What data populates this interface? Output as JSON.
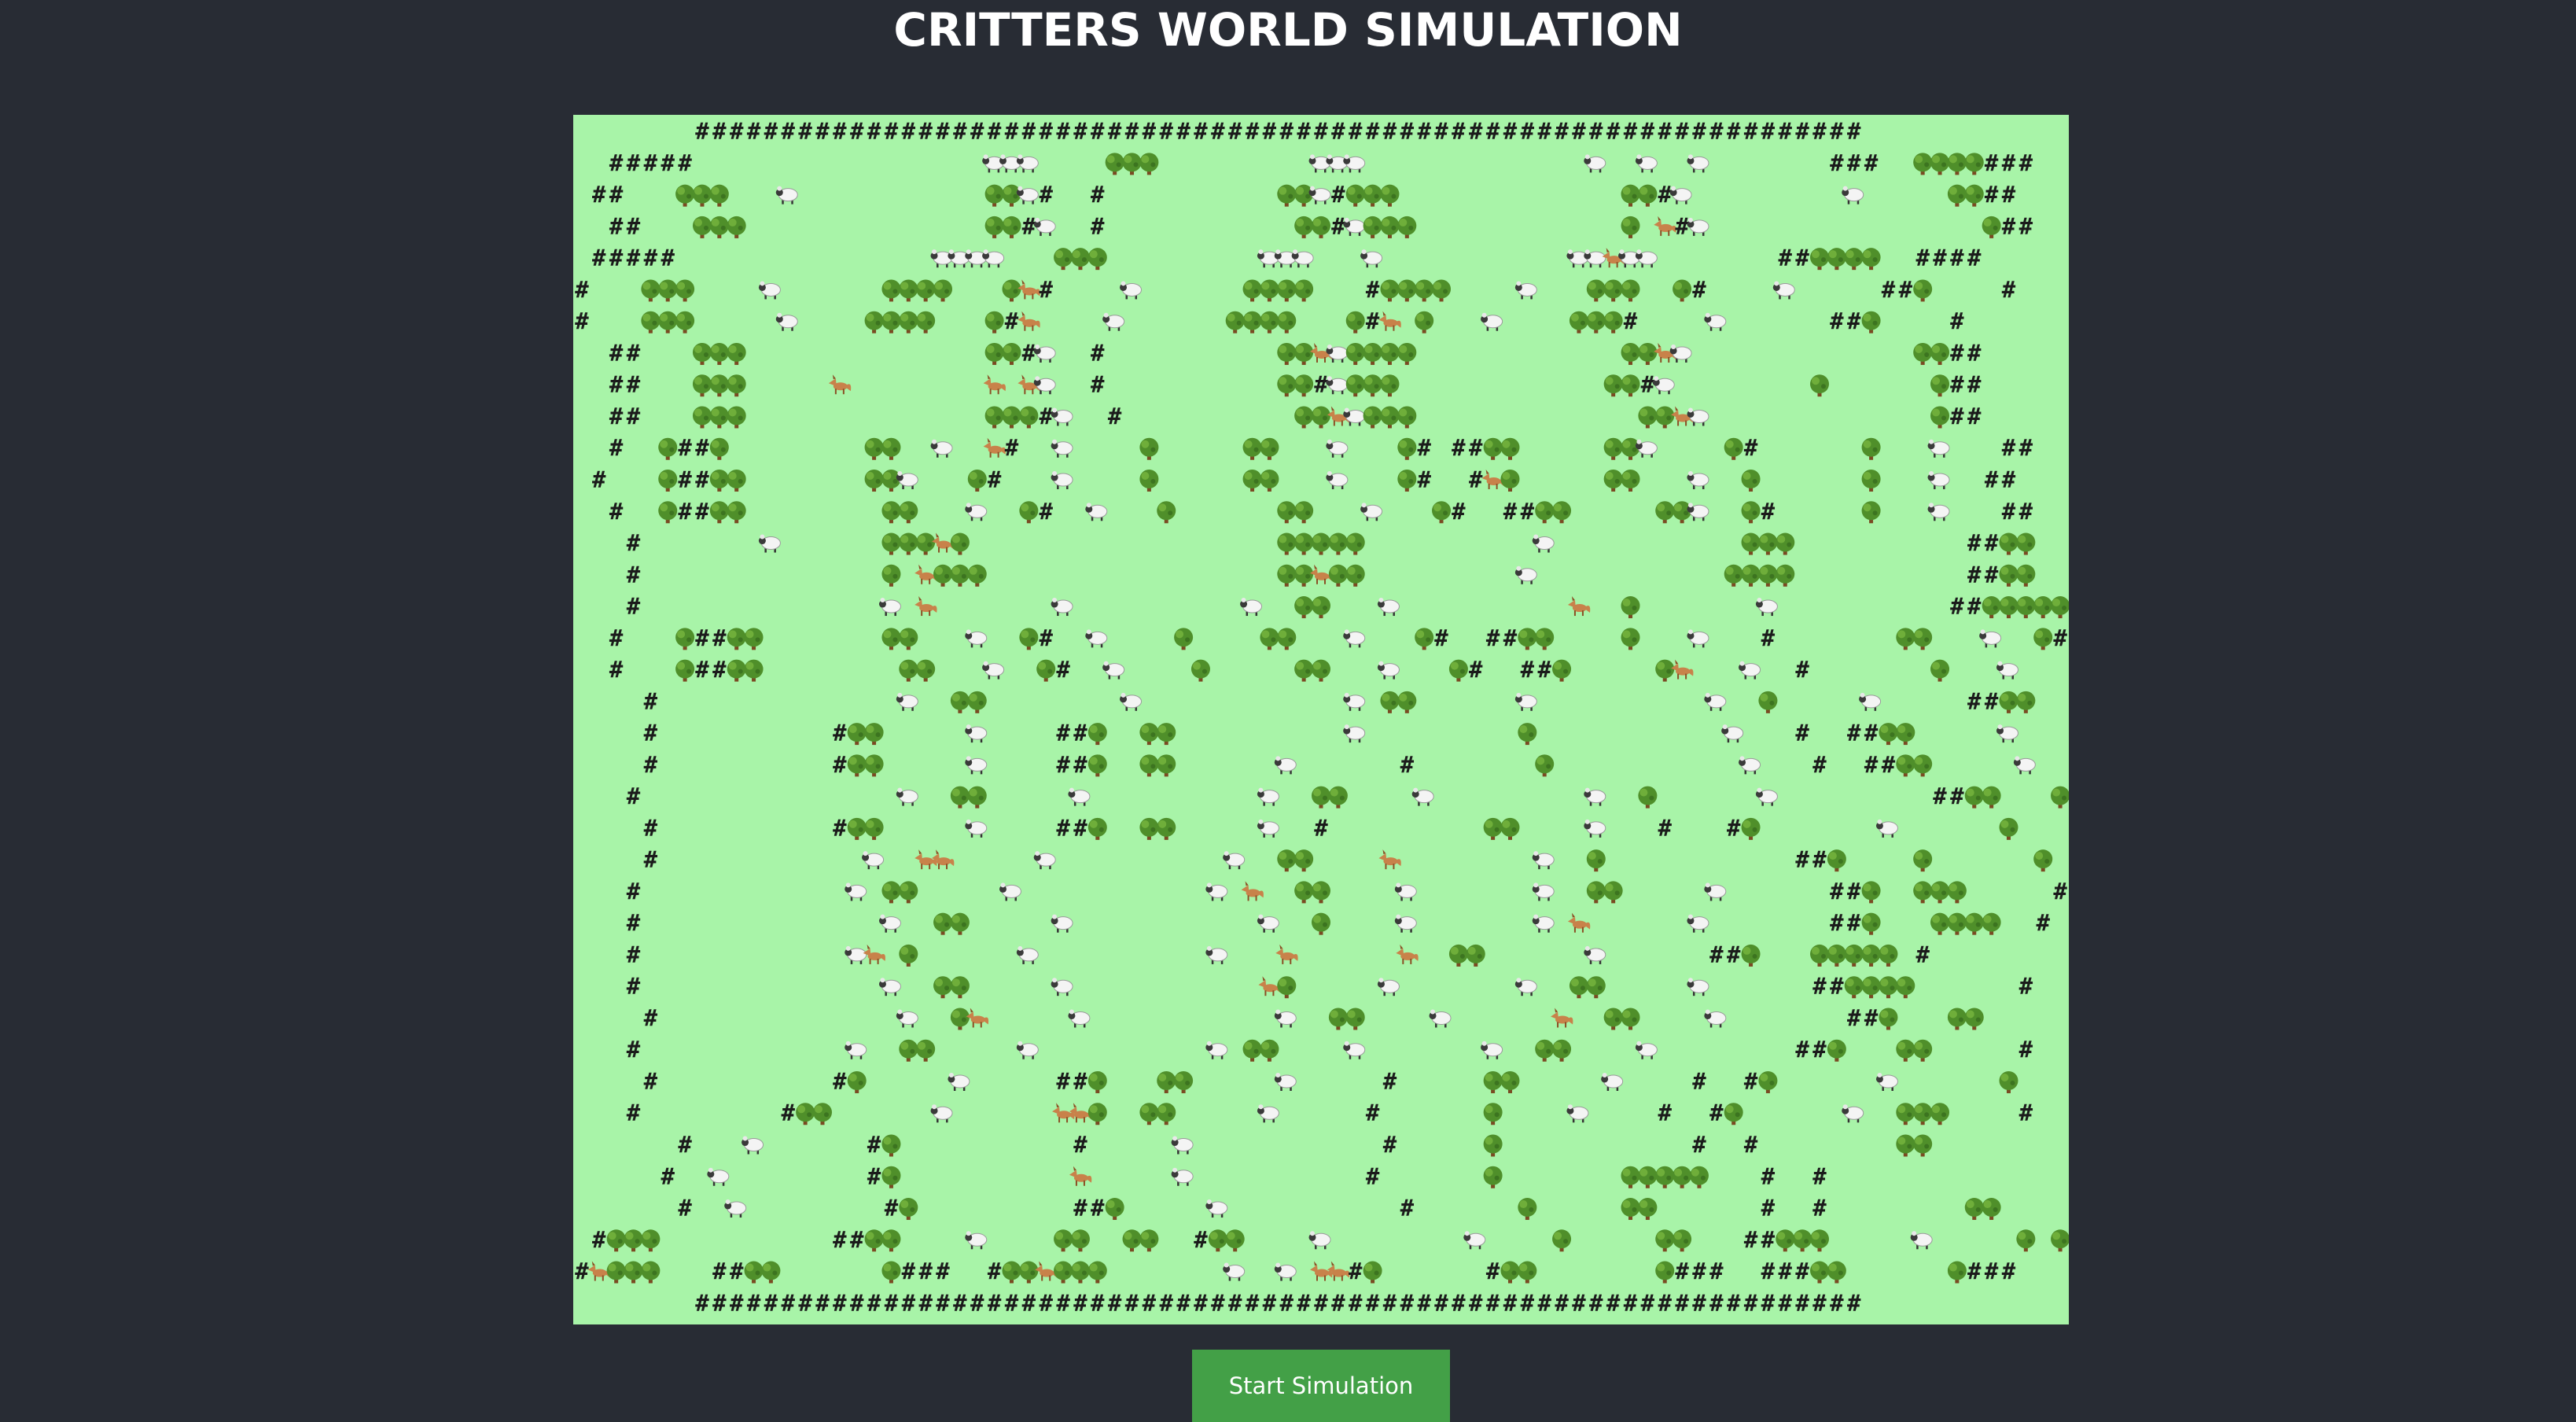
{
  "page": {
    "title": "CRITTERS WORLD SIMULATION",
    "start_button_label": "Start Simulation"
  },
  "legend_symbols": {
    "wall": "#",
    "tree": "tree-icon",
    "sheep": "sheep-icon",
    "fox": "fox-icon"
  },
  "colors": {
    "page_background": "#282c34",
    "grass": "#a8f4a8",
    "button": "#43a047",
    "wall_text": "#1b1b1b",
    "tree_canopy": "#4f8f2a",
    "sheep_wool": "#f4f4f4",
    "fox_fur": "#c8824a"
  },
  "world": {
    "columns": 87,
    "rows": 38,
    "grid": [
      "       ####################################################################        ",
      "  #####                 SSS    TTT         SSS             S  S  S       ###  TTTT###",
      " ##   TTT   S           TTS#  #          TTS#TTT             TT#S         S     TT## ",
      "  ##   TTT              TT#S  #           TT#STTT            T F#S                T##",
      " #####               SSSS   TTT         SSS   S           SSFSS       ##TTTT  ####  ",
      "#   TTT    S      TTTT   TF#    S      TTTT   #TTTT    S   TTT  T#    S     ##T    #  ",
      "#   TTT     S    TTTT   T#F    S      TTTT   T#F T   S    TTT#    S      ##T    #   ",
      "  ##   TTT              TT#S  #          TTFSTTTT            TTFS             TT##  ",
      "  ##   TTT     F        F FS  #          TT#STTT            TT#S        T      T## ",
      "  ##   TTT              TTT#S  #          TTFSTTT             TTFS             T## ",
      "  #  T##T        TT  S  F#  S    T     TT   S   T# ##TT     TTS    T#      T   S   ## ",
      " #   T##TT       TTS   T#   S    T     TT   S   T#  #FT     TT   S  T      T   S  ##  ",
      "  #  T##TT        TT   S  T#  S   T      TT   S   T#  ##TT     TTS  T#     T   S   ## ",
      "   #       S      TTTFT                  TTTTT          S           TTT          ##TT   # ",
      "   #              T FTTT                 TTFTT         S           TTTT          ##TT   #",
      "   #              S F       S          S  TT   S          F  T       S          ##TTTTT  #",
      "  #   T##TT       TT   S  T#  S    T    TT   S   T#  ##TT    T   S   #       TT   S  T##  ",
      "  #   T##TT        TT   S  T#  S    T     TT   S   T#  ##T     TF   S  #       T   S   T##",
      "    #              S  TT        S            S TT      S          S  T     S     ##TT  ",
      "    #          #TT     S    ##T  TT          S         T           S   #  ##TT     S  ",
      "    #          #TT     S    ##T  TT      S      #       T           S   #  ##TT     S  T",
      "   #               S  TT     S          S  TT    S         S  T      S         ##TT   T  T  T  #",
      "    #          #TT     S    ##T  TT     S  #         TT    S   #   #T       S      T",
      "    #            S  FF     S          S  TT    F        S  T           ##T    T      T",
      "   #            S TT     S           S F  TT    S       S  TT     S      ##T  TTT     #",
      "   #              S  TT     S           S  T    S       S F      S       ##T   TTTT  #",
      "   #            SF T      S          S   F      F  TT      S      ##T   TTTTT #",
      "   #              S  TT     S           FT     S       S  TT     S      ##TTTT      #",
      "    #              S  TF     S           S  TT    S      F  TT    S       ##T   TT",
      "   #            S  TT     S          S TT    S       S  TT    S        ##T   TT     #",
      "    #          #T     S     ##T   TT     S     #     TT     S    #  #T      S      T",
      "   #        #TT      S      FFT  TT     S     #      T    S    #  #T      S  TTT    #",
      "      #   S      #T          #     S           #     T           #  #        TT",
      "     #  S        #T          F     S          #      T       TTTTT   #  #",
      "      #  S        #T         ##T     S          #      T     TT      #  #        TT",
      " #TTT          ##TT    S    TT  TT  #TT    S        S    T     TT   ##TTT     S     T T#",
      "#FTTT   ##TT      T###  #TTFTTT       S  S FF#T      #TT       T###  ###TT      T###",
      "       ####################################################################        "
    ]
  }
}
